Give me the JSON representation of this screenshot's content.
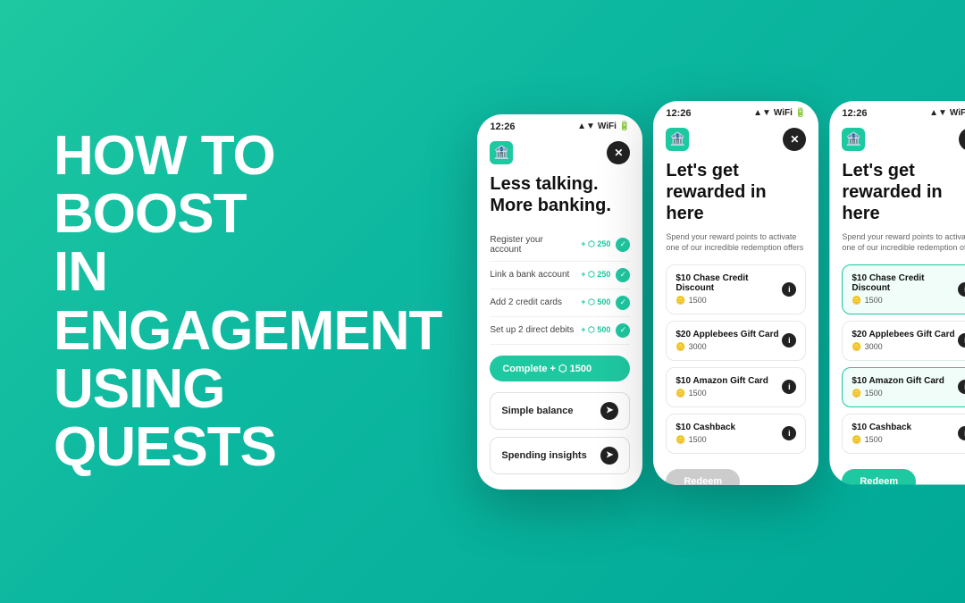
{
  "background": {
    "gradient_start": "#1ec8a0",
    "gradient_end": "#00a896"
  },
  "heading": {
    "line1": "HOW TO BOOST",
    "line2": "IN ENGAGEMENT",
    "line3": "USING QUESTS"
  },
  "phone1": {
    "time": "12:26",
    "title_line1": "Less talking.",
    "title_line2": "More banking.",
    "tasks": [
      {
        "label": "Register your account",
        "points": "+ ⬡ 250"
      },
      {
        "label": "Link a bank account",
        "points": "+ ⬡ 250"
      },
      {
        "label": "Add 2 credit cards",
        "points": "+ ⬡ 500"
      },
      {
        "label": "Set up 2 direct debits",
        "points": "+ ⬡ 500"
      }
    ],
    "complete_btn": "Complete  + ⬡ 1500",
    "menu_items": [
      "Simple balance",
      "Spending insights"
    ]
  },
  "phone2": {
    "time": "12:26",
    "title": "Let's get rewarded in here",
    "subtitle": "Spend your reward points to activate one of our incredible redemption offers",
    "rewards": [
      {
        "name": "$10 Chase Credit Discount",
        "points": "1500",
        "selected": false
      },
      {
        "name": "$20 Applebees Gift Card",
        "points": "3000",
        "selected": false
      },
      {
        "name": "$10 Amazon Gift Card",
        "points": "1500",
        "selected": false
      },
      {
        "name": "$10 Cashback",
        "points": "1500",
        "selected": false
      }
    ],
    "redeem_btn": "Redeem",
    "redeem_active": false
  },
  "phone3": {
    "time": "12:26",
    "title": "Let's get rewarded in here",
    "subtitle": "Spend your reward points to activate one of our incredible redemption offers",
    "rewards": [
      {
        "name": "$10 Chase Credit Discount",
        "points": "1500",
        "selected": true
      },
      {
        "name": "$20 Applebees Gift Card",
        "points": "3000",
        "selected": false
      },
      {
        "name": "$10 Amazon Gift Card",
        "points": "1500",
        "selected": true
      },
      {
        "name": "$10 Cashback",
        "points": "1500",
        "selected": false
      }
    ],
    "redeem_btn": "Redeem",
    "redeem_active": true
  }
}
